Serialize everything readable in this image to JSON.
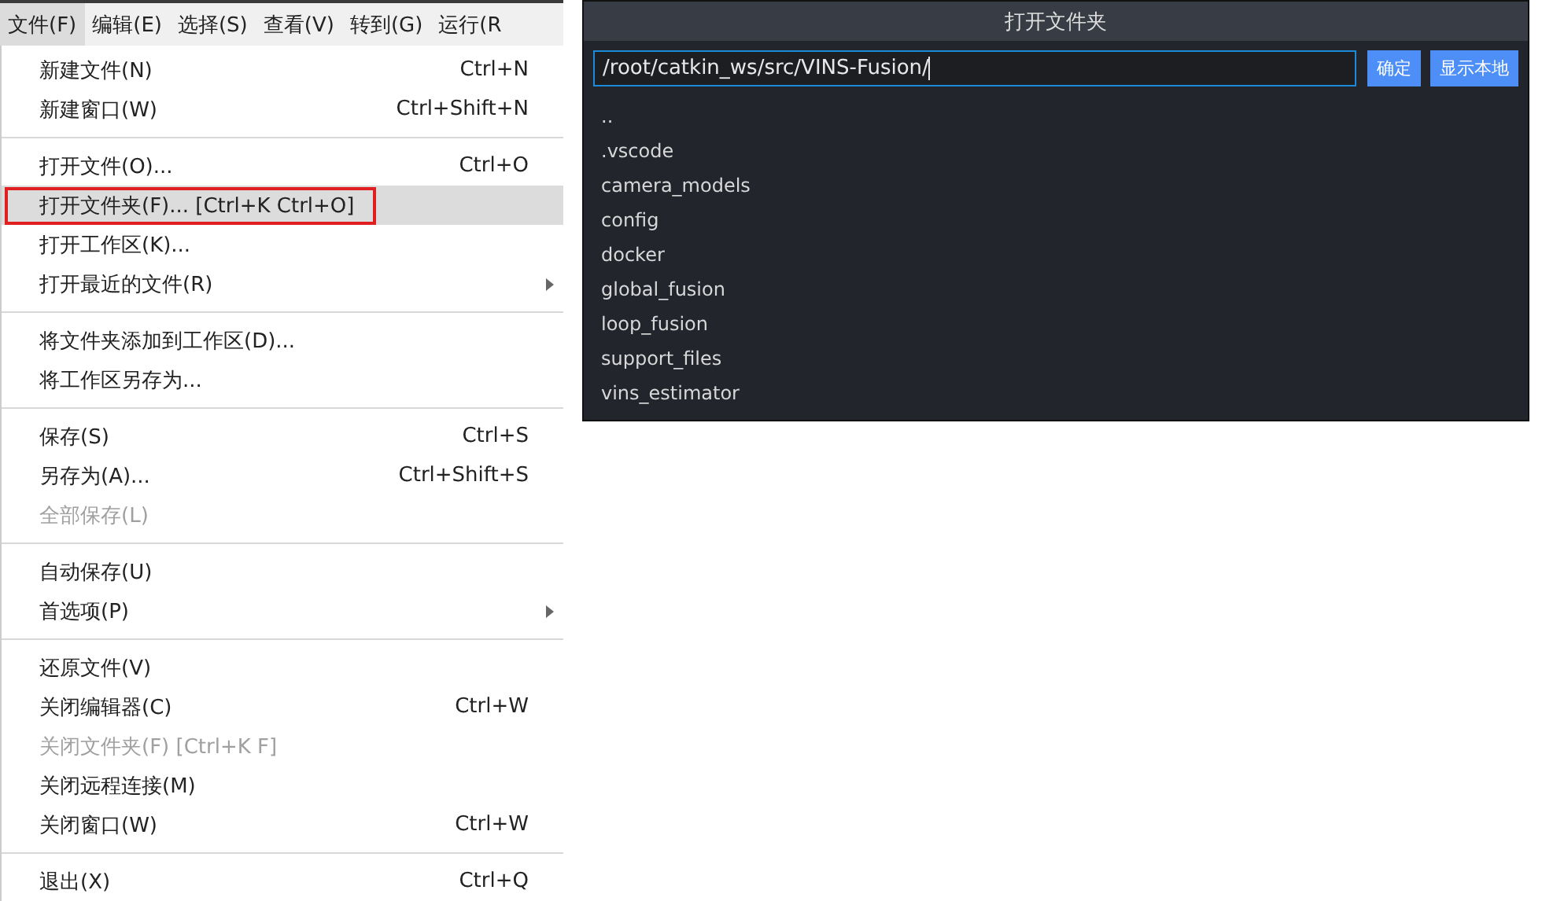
{
  "menu_bar": [
    {
      "label": "文件(F)",
      "selected": true
    },
    {
      "label": "编辑(E)",
      "selected": false
    },
    {
      "label": "选择(S)",
      "selected": false
    },
    {
      "label": "查看(V)",
      "selected": false
    },
    {
      "label": "转到(G)",
      "selected": false
    },
    {
      "label": "运行(R",
      "selected": false
    }
  ],
  "file_menu": {
    "groups": [
      [
        {
          "label": "新建文件(N)",
          "shortcut": "Ctrl+N",
          "selected": false,
          "disabled": false,
          "boxed": false,
          "submenu": false
        },
        {
          "label": "新建窗口(W)",
          "shortcut": "Ctrl+Shift+N",
          "selected": false,
          "disabled": false,
          "boxed": false,
          "submenu": false
        }
      ],
      [
        {
          "label": "打开文件(O)...",
          "shortcut": "Ctrl+O",
          "selected": false,
          "disabled": false,
          "boxed": false,
          "submenu": false
        },
        {
          "label": "打开文件夹(F)... [Ctrl+K Ctrl+O]",
          "selected": true,
          "disabled": false,
          "boxed": true,
          "submenu": false
        },
        {
          "label": "打开工作区(K)...",
          "selected": false,
          "disabled": false,
          "boxed": false,
          "submenu": false
        },
        {
          "label": "打开最近的文件(R)",
          "selected": false,
          "disabled": false,
          "boxed": false,
          "submenu": true
        }
      ],
      [
        {
          "label": "将文件夹添加到工作区(D)...",
          "selected": false,
          "disabled": false,
          "boxed": false,
          "submenu": false
        },
        {
          "label": "将工作区另存为...",
          "selected": false,
          "disabled": false,
          "boxed": false,
          "submenu": false
        }
      ],
      [
        {
          "label": "保存(S)",
          "shortcut": "Ctrl+S",
          "selected": false,
          "disabled": false,
          "boxed": false,
          "submenu": false
        },
        {
          "label": "另存为(A)...",
          "shortcut": "Ctrl+Shift+S",
          "selected": false,
          "disabled": false,
          "boxed": false,
          "submenu": false
        },
        {
          "label": "全部保存(L)",
          "selected": false,
          "disabled": true,
          "boxed": false,
          "submenu": false
        }
      ],
      [
        {
          "label": "自动保存(U)",
          "selected": false,
          "disabled": false,
          "boxed": false,
          "submenu": false
        },
        {
          "label": "首选项(P)",
          "selected": false,
          "disabled": false,
          "boxed": false,
          "submenu": true
        }
      ],
      [
        {
          "label": "还原文件(V)",
          "selected": false,
          "disabled": false,
          "boxed": false,
          "submenu": false
        },
        {
          "label": "关闭编辑器(C)",
          "shortcut": "Ctrl+W",
          "selected": false,
          "disabled": false,
          "boxed": false,
          "submenu": false
        },
        {
          "label": "关闭文件夹(F) [Ctrl+K F]",
          "selected": false,
          "disabled": true,
          "boxed": false,
          "submenu": false
        },
        {
          "label": "关闭远程连接(M)",
          "selected": false,
          "disabled": false,
          "boxed": false,
          "submenu": false
        },
        {
          "label": "关闭窗口(W)",
          "shortcut": "Ctrl+W",
          "selected": false,
          "disabled": false,
          "boxed": false,
          "submenu": false
        }
      ],
      [
        {
          "label": "退出(X)",
          "shortcut": "Ctrl+Q",
          "selected": false,
          "disabled": false,
          "boxed": false,
          "submenu": false
        }
      ]
    ]
  },
  "dialog": {
    "title": "打开文件夹",
    "path": "/root/catkin_ws/src/VINS-Fusion/",
    "buttons": [
      "确定",
      "显示本地"
    ],
    "entries": [
      "..",
      ".vscode",
      "camera_models",
      "config",
      "docker",
      "global_fusion",
      "loop_fusion",
      "support_files",
      "vins_estimator"
    ]
  }
}
